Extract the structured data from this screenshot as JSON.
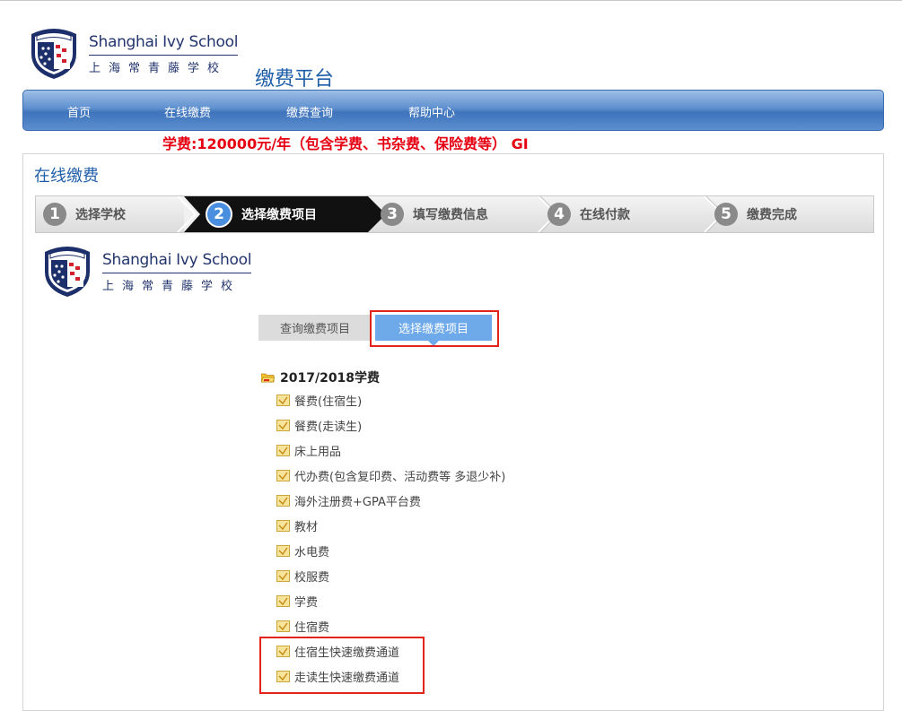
{
  "header": {
    "logo_en": "Shanghai Ivy School",
    "logo_cn": "上海常青藤学校",
    "logo_badge": "IVY SCHOOL",
    "platform_title": "缴费平台"
  },
  "nav": {
    "items": [
      {
        "label": "首页"
      },
      {
        "label": "在线缴费"
      },
      {
        "label": "缴费查询"
      },
      {
        "label": "帮助中心"
      }
    ]
  },
  "notice": "学费:120000元/年（包含学费、书杂费、保险费等） GI",
  "panel": {
    "title": "在线缴费",
    "steps": [
      {
        "num": "1",
        "label": "选择学校"
      },
      {
        "num": "2",
        "label": "选择缴费项目"
      },
      {
        "num": "3",
        "label": "填写缴费信息"
      },
      {
        "num": "4",
        "label": "在线付款"
      },
      {
        "num": "5",
        "label": "缴费完成"
      }
    ],
    "active_step": 2
  },
  "tabs": {
    "query": "查询缴费项目",
    "select": "选择缴费项目"
  },
  "tree": {
    "root": "2017/2018学费",
    "items": [
      "餐费(住宿生)",
      "餐费(走读生)",
      "床上用品",
      "代办费(包含复印费、活动费等 多退少补)",
      "海外注册费+GPA平台费",
      "教材",
      "水电费",
      "校服费",
      "学费",
      "住宿费",
      "住宿生快速缴费通道",
      "走读生快速缴费通道"
    ]
  },
  "colors": {
    "brand_blue": "#1f5ea9",
    "notice_red": "#e60012",
    "highlight_red": "#e2231a",
    "tab_active": "#6ea9ea"
  }
}
